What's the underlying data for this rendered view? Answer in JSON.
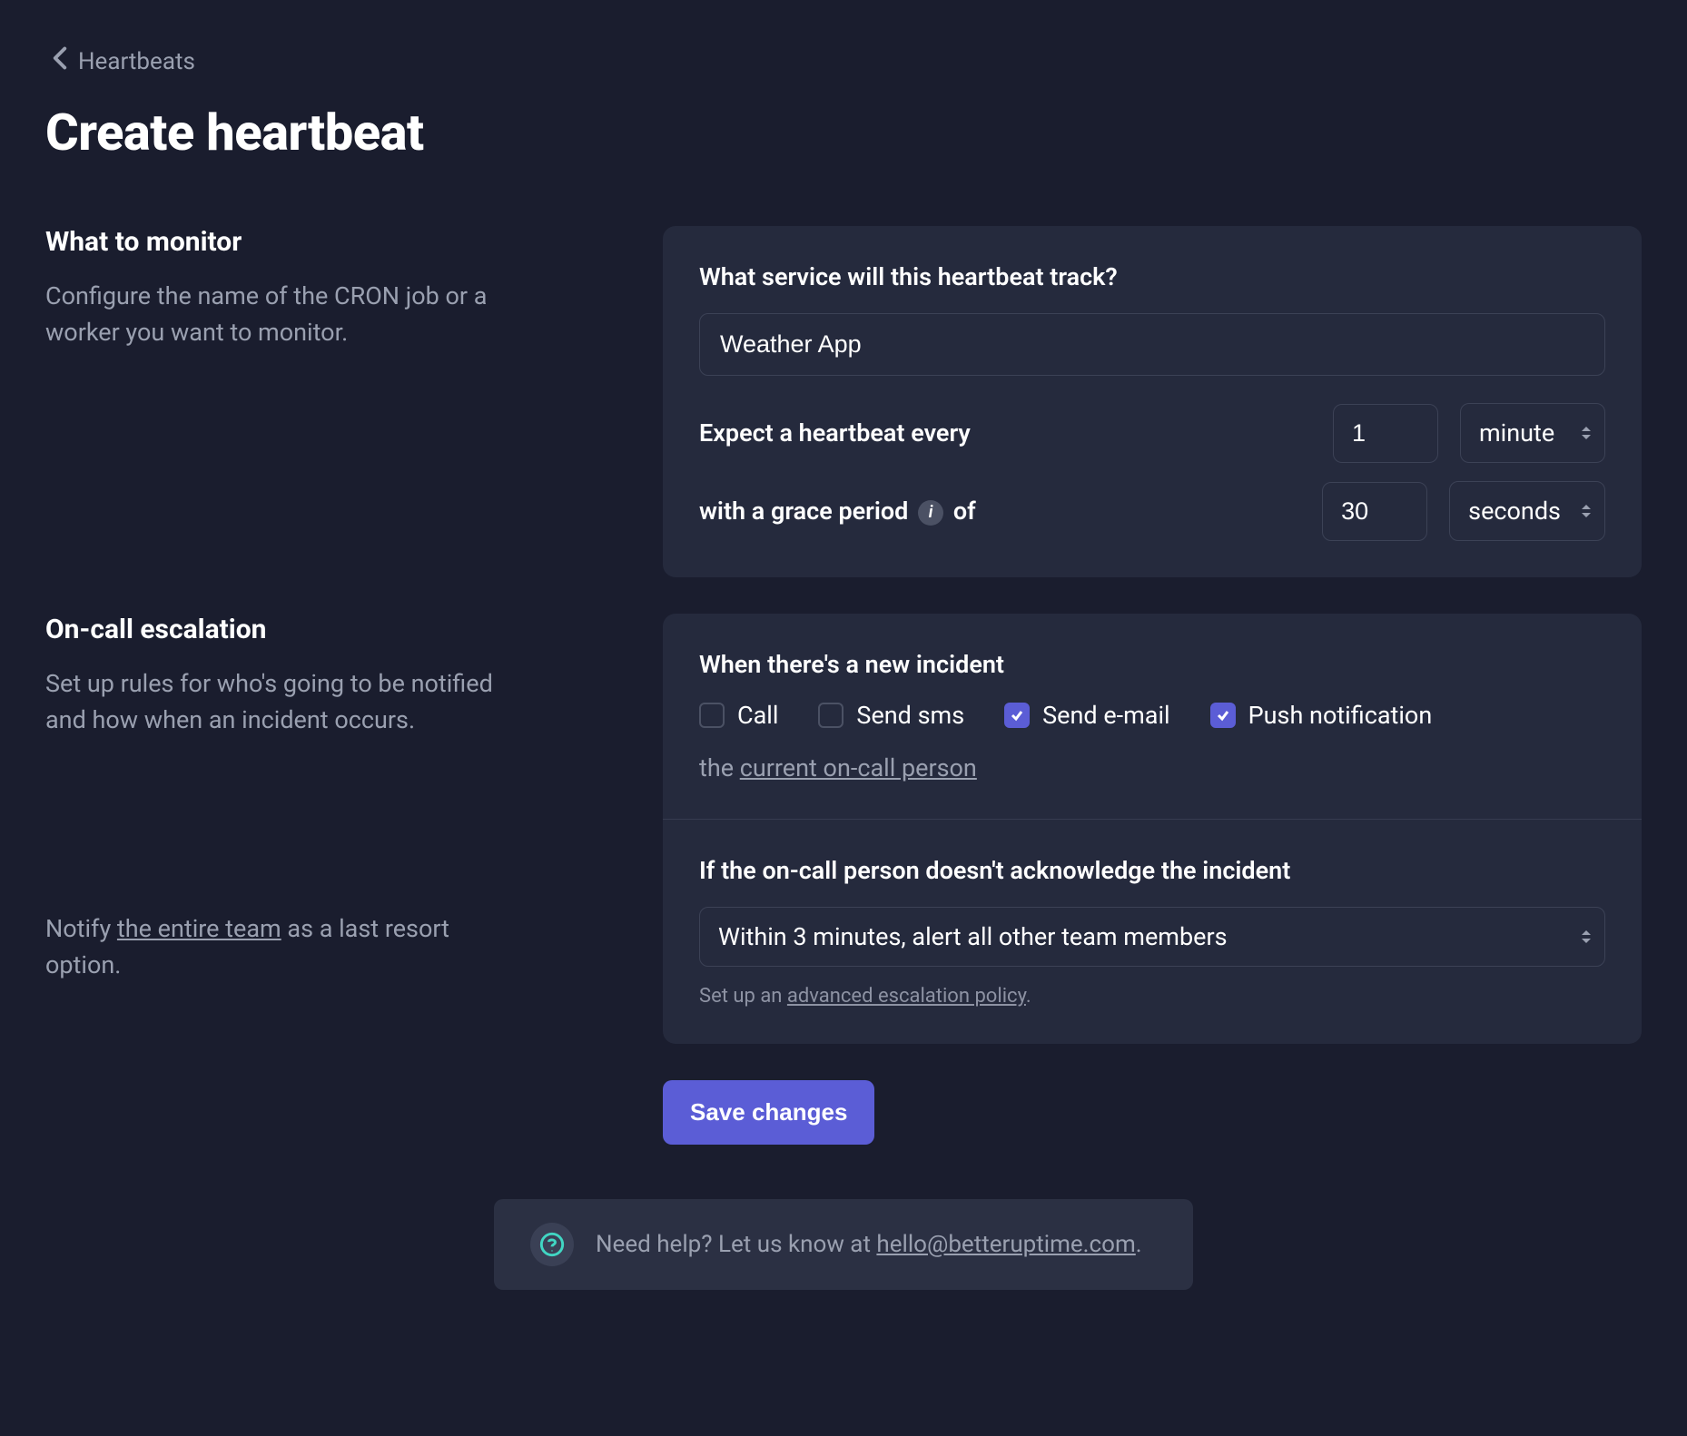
{
  "nav": {
    "back": "Heartbeats"
  },
  "title": "Create heartbeat",
  "section1": {
    "heading": "What to monitor",
    "desc": "Configure the name of the CRON job or a worker you want to monitor.",
    "service_label": "What service will this heartbeat track?",
    "service_value": "Weather App",
    "expect_label": "Expect a heartbeat every",
    "expect_value": "1",
    "expect_unit": "minute",
    "grace_pre": "with a grace period",
    "grace_post": "of",
    "grace_value": "30",
    "grace_unit": "seconds"
  },
  "section2": {
    "heading": "On-call escalation",
    "desc": "Set up rules for who's going to be notified and how when an incident occurs.",
    "incident_label": "When there's a new incident",
    "checkboxes": {
      "call": "Call",
      "sms": "Send sms",
      "email": "Send e-mail",
      "push": "Push notification"
    },
    "checked": {
      "call": false,
      "sms": false,
      "email": true,
      "push": true
    },
    "oncall_pre": "the ",
    "oncall_link": "current on-call person"
  },
  "section3": {
    "left_pre": "Notify ",
    "left_link": "the entire team",
    "left_post": " as a last resort option.",
    "ack_label": "If the on-call person doesn't acknowledge the incident",
    "ack_select": "Within 3 minutes, alert all other team members",
    "adv_pre": "Set up an ",
    "adv_link": "advanced escalation policy",
    "adv_post": "."
  },
  "actions": {
    "save": "Save changes"
  },
  "help": {
    "pre": "Need help? Let us know at ",
    "email": "hello@betteruptime.com",
    "post": "."
  }
}
